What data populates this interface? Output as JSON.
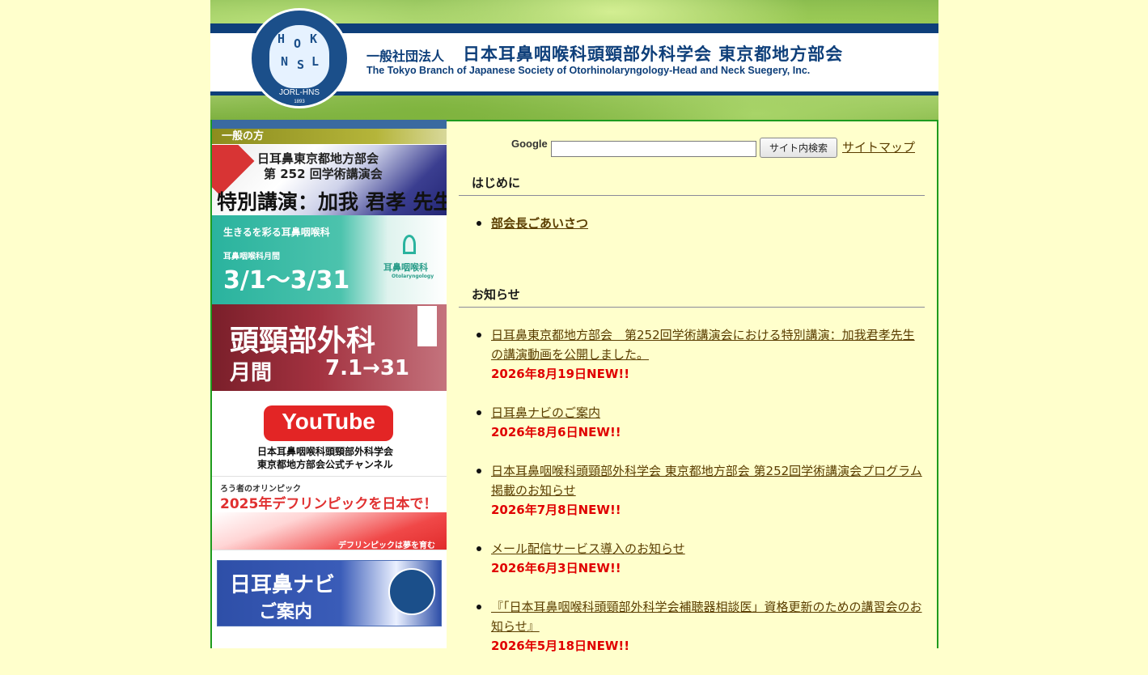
{
  "header": {
    "org_type": "一般社団法人",
    "org_name": "日本耳鼻咽喉科頭頸部外科学会 東京都地方部会",
    "org_name_en": "The Tokyo Branch of Japanese Society of Otorhinolaryngology-Head and Neck Suegery, Inc.",
    "logo_text": "JORL-HNS",
    "logo_year": "1893"
  },
  "sidebar": {
    "section_title": "一般の方",
    "banners": [
      {
        "line1": "日耳鼻東京都地方部会",
        "line2": "第 252 回学術講演会",
        "line3": "特別講演：加我 君孝 先生"
      },
      {
        "line1": "生きるを彩る耳鼻咽喉科",
        "line2": "耳鼻咽喉科月間",
        "line3": "3/1～3/31",
        "logo": "耳鼻咽喉科",
        "logo_sub": "Otolaryngology"
      },
      {
        "line1": "頭頸部外科",
        "line2": "月間",
        "line3": "7.1→31"
      },
      {
        "line1": "YouTube",
        "line2": "日本耳鼻咽喉科頭頸部外科学会",
        "line3": "東京都地方部会公式チャンネル"
      },
      {
        "line1": "ろう者のオリンピック",
        "line2": "2025年デフリンピックを日本で！",
        "line3": "デフリンピックは夢を育む"
      },
      {
        "line1": "日耳鼻ナビ",
        "line2": "ご案内"
      }
    ]
  },
  "search": {
    "label": "Google",
    "value": "",
    "button_label": "サイト内検索",
    "sitemap_label": "サイトマップ"
  },
  "intro": {
    "heading": "はじめに",
    "items": [
      {
        "label": "部会長ごあいさつ"
      }
    ]
  },
  "news": {
    "heading": "お知らせ",
    "items": [
      {
        "title": "日耳鼻東京都地方部会　第252回学術講演会における特別講演：加我君孝先生の講演動画を公開しました。",
        "date": "2026年8月19日NEW!!"
      },
      {
        "title": "日耳鼻ナビのご案内",
        "date": "2026年8月6日NEW!!"
      },
      {
        "title": "日本耳鼻咽喉科頭頸部外科学会 東京都地方部会 第252回学術講演会プログラム掲載のお知らせ",
        "date": "2026年7月8日NEW!!"
      },
      {
        "title": "メール配信サービス導入のお知らせ",
        "date": "2026年6月3日NEW!!"
      },
      {
        "title": "『「日本耳鼻咽喉科頭頸部外科学会補聴器相談医」資格更新のための講習会のお知らせ』",
        "date": "2026年5月18日NEW!!"
      }
    ]
  }
}
